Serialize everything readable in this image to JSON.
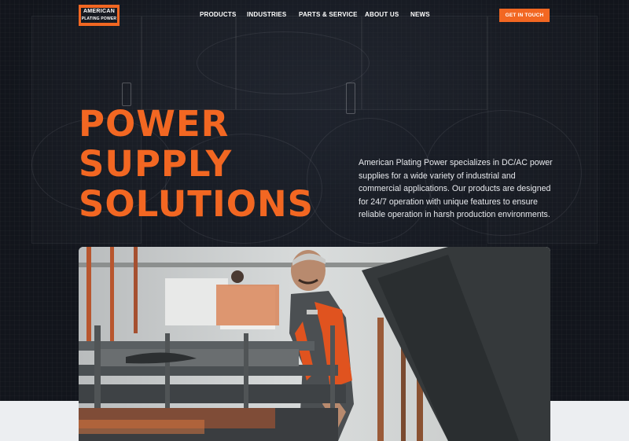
{
  "header": {
    "logo": {
      "line1": "AMERICAN",
      "line2": "PLATING POWER"
    },
    "nav": [
      "PRODUCTS",
      "INDUSTRIES",
      "PARTS & SERVICE",
      "ABOUT US",
      "NEWS"
    ],
    "cta_label": "GET IN TOUCH"
  },
  "hero": {
    "headline": [
      "POWER",
      "SUPPLY",
      "SOLUTIONS"
    ],
    "intro": "American Plating Power specializes in DC/AC power supplies for a wide variety of industrial and commercial applications. Our products are designed for 24/7 operation with unique features to ensure reliable operation in harsh production environments."
  },
  "colors": {
    "accent": "#f26722",
    "hero_bg": "#12151c",
    "page_bg": "#eceef1"
  }
}
